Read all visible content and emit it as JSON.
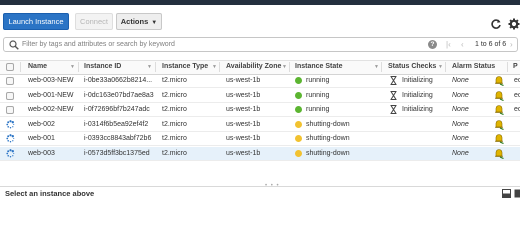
{
  "toolbar": {
    "launch_label": "Launch Instance",
    "connect_label": "Connect",
    "actions_label": "Actions"
  },
  "filter": {
    "placeholder": "Filter by tags and attributes or search by keyword",
    "help": "?",
    "pager_text": "1 to 6 of 6"
  },
  "table": {
    "headers": {
      "name": "Name",
      "instance_id": "Instance ID",
      "instance_type": "Instance Type",
      "availability_zone": "Availability Zone",
      "instance_state": "Instance State",
      "status_checks": "Status Checks",
      "alarm_status": "Alarm Status",
      "public_dns": "P"
    },
    "rows": [
      {
        "name": "web-003-NEW",
        "instance_id": "i-0be33a0662b8214...",
        "instance_type": "t2.micro",
        "zone": "us-west-1b",
        "state": "running",
        "state_color": "#5cb531",
        "status": "Initializing",
        "alarm": "None",
        "dns": "ec"
      },
      {
        "name": "web-001-NEW",
        "instance_id": "i-0dc163e07bd7ae8a3",
        "instance_type": "t2.micro",
        "zone": "us-west-1b",
        "state": "running",
        "state_color": "#5cb531",
        "status": "Initializing",
        "alarm": "None",
        "dns": "ec"
      },
      {
        "name": "web-002-NEW",
        "instance_id": "i-0f72696bf7b247adc",
        "instance_type": "t2.micro",
        "zone": "us-west-1b",
        "state": "running",
        "state_color": "#5cb531",
        "status": "Initializing",
        "alarm": "None",
        "dns": "ec"
      },
      {
        "name": "web-002",
        "instance_id": "i-0314f6b5ea92ef4f2",
        "instance_type": "t2.micro",
        "zone": "us-west-1b",
        "state": "shutting-down",
        "state_color": "#f2c230",
        "status": "",
        "alarm": "None",
        "dns": ""
      },
      {
        "name": "web-001",
        "instance_id": "i-0393cc8843abf72b6",
        "instance_type": "t2.micro",
        "zone": "us-west-1b",
        "state": "shutting-down",
        "state_color": "#f2c230",
        "status": "",
        "alarm": "None",
        "dns": ""
      },
      {
        "name": "web-003",
        "instance_id": "i-0573d5ff3bc1375ed",
        "instance_type": "t2.micro",
        "zone": "us-west-1b",
        "state": "shutting-down",
        "state_color": "#f2c230",
        "status": "",
        "alarm": "None",
        "dns": ""
      }
    ]
  },
  "detail": {
    "message": "Select an instance above",
    "handle": "• • •"
  },
  "colors": {
    "primary": "#2b74c5",
    "running": "#5cb531",
    "shutting_down": "#f2c230",
    "selected_row": "#e6f1fa"
  }
}
